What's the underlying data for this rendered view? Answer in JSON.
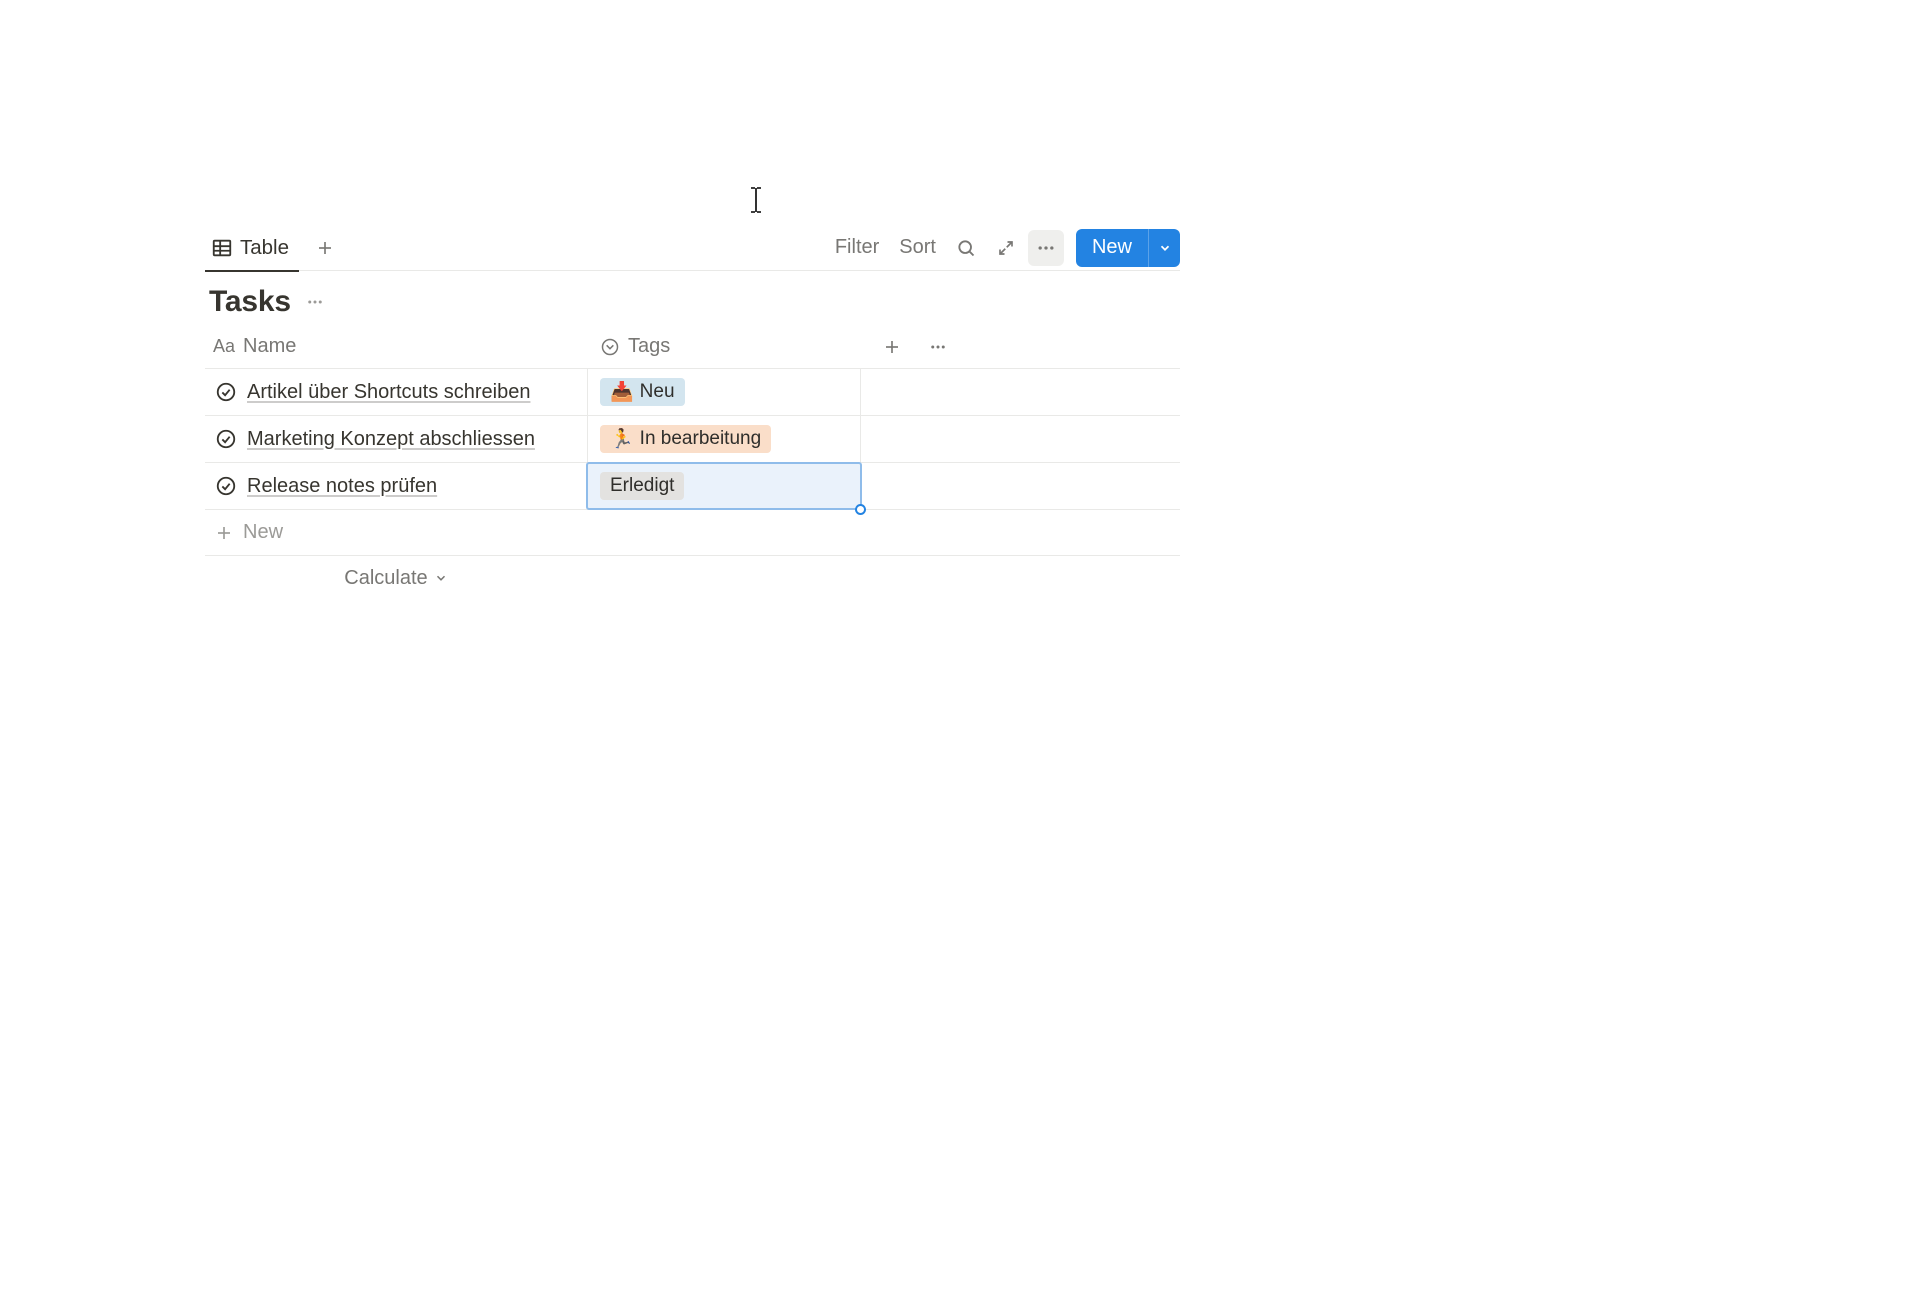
{
  "toolbar": {
    "tab_label": "Table",
    "filter_label": "Filter",
    "sort_label": "Sort",
    "new_label": "New"
  },
  "title": "Tasks",
  "columns": {
    "name": "Name",
    "tags": "Tags"
  },
  "rows": [
    {
      "name": "Artikel über Shortcuts schreiben",
      "tag": {
        "emoji": "📥",
        "label": "Neu",
        "color": "blue"
      },
      "selected": false
    },
    {
      "name": "Marketing Konzept abschliessen",
      "tag": {
        "emoji": "🏃",
        "label": "In bearbeitung",
        "color": "orange"
      },
      "selected": false
    },
    {
      "name": "Release notes prüfen",
      "tag": {
        "emoji": "",
        "label": "Erledigt",
        "color": "gray"
      },
      "selected": true
    }
  ],
  "new_row_label": "New",
  "calculate_label": "Calculate"
}
